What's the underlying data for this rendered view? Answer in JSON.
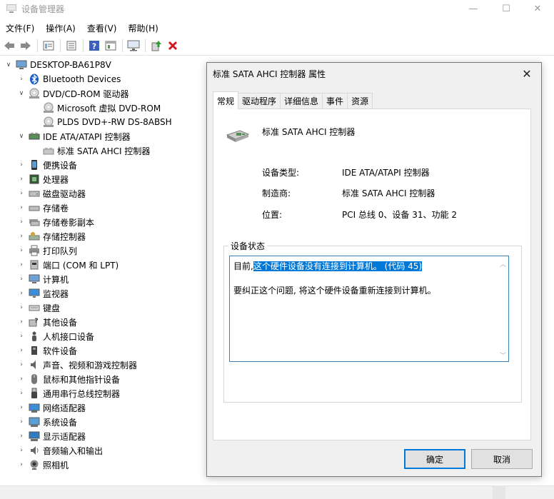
{
  "window": {
    "title": "设备管理器",
    "minimize": "—",
    "maximize": "☐",
    "close": "✕"
  },
  "menu": [
    "文件(F)",
    "操作(A)",
    "查看(V)",
    "帮助(H)"
  ],
  "toolbar": {
    "buttons": [
      "back-icon",
      "forward-icon",
      "properties-icon",
      "details-icon",
      "help-icon",
      "show-hidden-icon",
      "scan-hardware-icon",
      "update-driver-icon",
      "uninstall-icon"
    ]
  },
  "tree": {
    "root": "DESKTOP-BA61P8V",
    "bluetooth": "Bluetooth Devices",
    "dvd": "DVD/CD-ROM 驱动器",
    "dvd_child1": "Microsoft 虚拟 DVD-ROM",
    "dvd_child2": "PLDS DVD+-RW DS-8ABSH",
    "ide": "IDE ATA/ATAPI 控制器",
    "ide_child": "标准 SATA AHCI 控制器",
    "portable": "便携设备",
    "cpu": "处理器",
    "disk": "磁盘驱动器",
    "storage_vol": "存储卷",
    "storage_shadow": "存储卷影副本",
    "storage_ctrl": "存储控制器",
    "print_queue": "打印队列",
    "ports": "端口 (COM 和 LPT)",
    "computer": "计算机",
    "monitor": "监视器",
    "keyboard": "键盘",
    "other": "其他设备",
    "hid": "人机接口设备",
    "software": "软件设备",
    "sound": "声音、视频和游戏控制器",
    "mouse": "鼠标和其他指针设备",
    "usb": "通用串行总线控制器",
    "network": "网络适配器",
    "system": "系统设备",
    "display": "显示适配器",
    "audio_io": "音频输入和输出",
    "camera": "照相机"
  },
  "dialog": {
    "title": "标准 SATA AHCI 控制器 属性",
    "close": "✕",
    "tabs": [
      "常规",
      "驱动程序",
      "详细信息",
      "事件",
      "资源"
    ],
    "device_name": "标准 SATA AHCI 控制器",
    "type_label": "设备类型:",
    "type_value": "IDE ATA/ATAPI 控制器",
    "mfr_label": "制造商:",
    "mfr_value": "标准 SATA AHCI 控制器",
    "loc_label": "位置:",
    "loc_value": "PCI 总线 0、设备 31、功能 2",
    "status_group": "设备状态",
    "status_prefix": "目前,",
    "status_selected": "这个硬件设备没有连接到计算机。 (代码 45)",
    "status_fix": "要纠正这个问题, 将这个硬件设备重新连接到计算机。",
    "ok": "确定",
    "cancel": "取消"
  }
}
